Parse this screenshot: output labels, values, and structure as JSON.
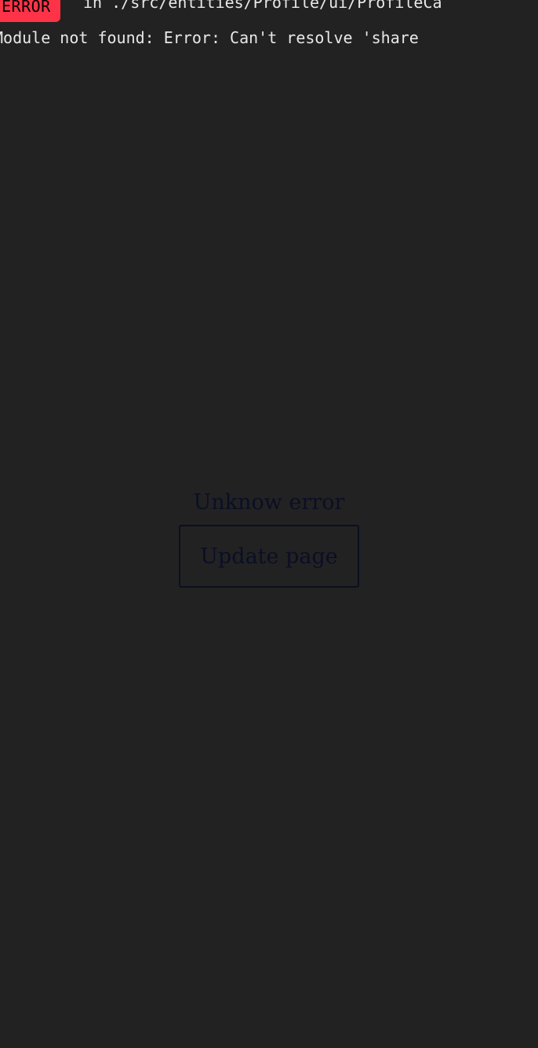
{
  "error_overlay": {
    "badge": "ERROR",
    "location": "in ./src/entities/Profile/ui/ProfileCa",
    "message": "Module not found: Error: Can't resolve 'share"
  },
  "fallback": {
    "title": "Unknow error",
    "button_label": "Update page"
  },
  "colors": {
    "background": "#222222",
    "error_badge": "#ff3348",
    "overlay_text": "#e8e8e8",
    "fallback_text": "#0a0f26"
  }
}
